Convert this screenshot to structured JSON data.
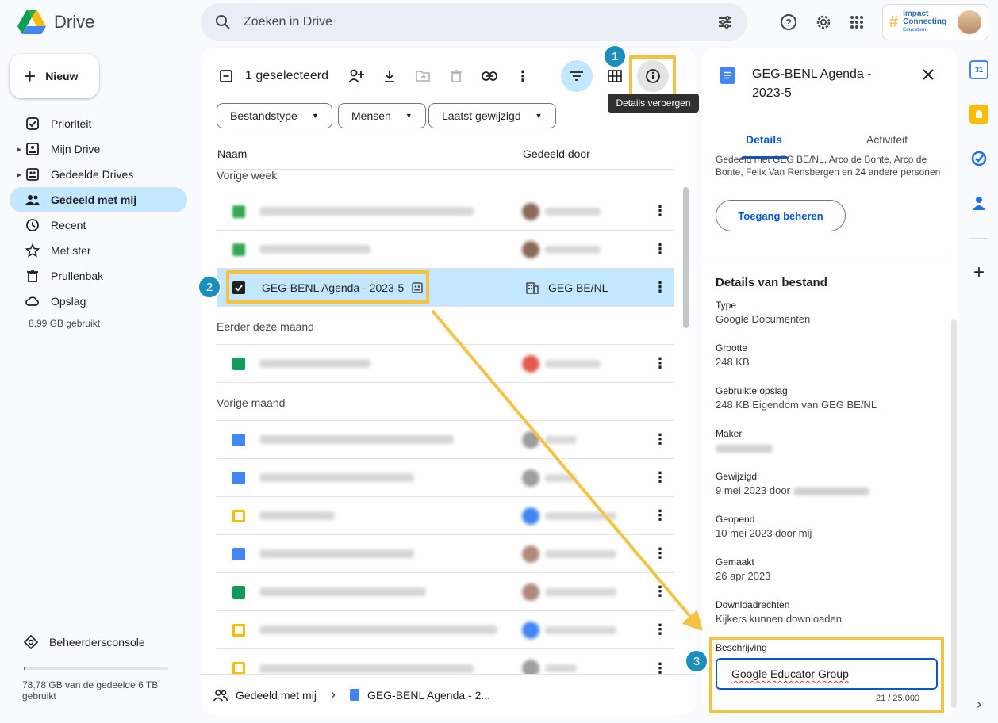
{
  "app": {
    "name": "Drive"
  },
  "search": {
    "placeholder": "Zoeken in Drive"
  },
  "account": {
    "brand_line1": "Impact",
    "brand_line2": "Connecting",
    "brand_line3": "Education"
  },
  "sidebar": {
    "new_label": "Nieuw",
    "items": [
      {
        "label": "Prioriteit"
      },
      {
        "label": "Mijn Drive"
      },
      {
        "label": "Gedeelde Drives"
      },
      {
        "label": "Gedeeld met mij"
      },
      {
        "label": "Recent"
      },
      {
        "label": "Met ster"
      },
      {
        "label": "Prullenbak"
      },
      {
        "label": "Opslag"
      }
    ],
    "quota_used": "8,99 GB gebruikt",
    "admin_label": "Beheerdersconsole",
    "storage_text": "78,78 GB van de gedeelde 6 TB gebruikt",
    "storage_fraction": 0.013
  },
  "toolbar": {
    "selected_label": "1 geselecteerd",
    "tooltip": "Details verbergen"
  },
  "filters": [
    {
      "label": "Bestandstype"
    },
    {
      "label": "Mensen"
    },
    {
      "label": "Laatst gewijzigd"
    }
  ],
  "columns": {
    "name": "Naam",
    "shared_by": "Gedeeld door"
  },
  "groups": [
    {
      "label": "Vorige week"
    },
    {
      "label": "Eerder deze maand"
    },
    {
      "label": "Vorige maand"
    }
  ],
  "selected_file": {
    "name": "GEG-BENL Agenda - 2023-5",
    "shared_by": "GEG BE/NL"
  },
  "breadcrumb": {
    "root": "Gedeeld met mij",
    "current": "GEG-BENL Agenda - 2..."
  },
  "details": {
    "title": "GEG-BENL Agenda - 2023-5",
    "tab_details": "Details",
    "tab_activity": "Activiteit",
    "shared_text": "Gedeeld met GEG BE/NL, Arco de Bonte, Arco de Bonte, Felix Van Rensbergen en 24 andere personen",
    "access_button": "Toegang beheren",
    "section_title": "Details van bestand",
    "fields": [
      {
        "label": "Type",
        "value": "Google Documenten"
      },
      {
        "label": "Grootte",
        "value": "248 KB"
      },
      {
        "label": "Gebruikte opslag",
        "value": "248 KB Eigendom van GEG BE/NL"
      },
      {
        "label": "Maker",
        "value": ""
      },
      {
        "label": "Gewijzigd",
        "value": "9 mei 2023 door"
      },
      {
        "label": "Geopend",
        "value": "10 mei 2023 door mij"
      },
      {
        "label": "Gemaakt",
        "value": "26 apr 2023"
      },
      {
        "label": "Downloadrechten",
        "value": "Kijkers kunnen downloaden"
      }
    ],
    "description_label": "Beschrijving",
    "description_value": "Google Educator Group",
    "char_count": "21 / 25.000"
  },
  "annotations": {
    "badge1": "1",
    "badge2": "2",
    "badge3": "3"
  },
  "colors": {
    "accent": "#0b57d0",
    "selection": "#c2e7ff",
    "highlight": "#f6c244",
    "badge": "#1a8fbf"
  }
}
